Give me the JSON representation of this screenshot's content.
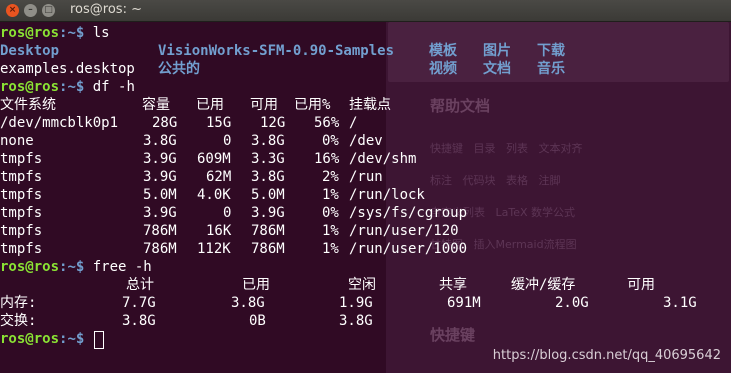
{
  "window": {
    "title": "ros@ros: ~"
  },
  "prompt": {
    "user_host": "ros@ros",
    "suffix": ":~$ "
  },
  "cmd1": "ls",
  "ls": {
    "row1": [
      "Desktop",
      "VisionWorks-SFM-0.90-Samples",
      "模板",
      "图片",
      "下载"
    ],
    "row2": [
      "examples.desktop",
      "公共的",
      "视频",
      "文档",
      "音乐"
    ]
  },
  "cmd2": "df -h",
  "df": {
    "headers": [
      "文件系统",
      "容量",
      "已用",
      "可用",
      "已用%",
      "挂载点"
    ],
    "rows": [
      [
        "/dev/mmcblk0p1",
        "28G",
        "15G",
        "12G",
        "56%",
        "/"
      ],
      [
        "none",
        "3.8G",
        "0",
        "3.8G",
        "0%",
        "/dev"
      ],
      [
        "tmpfs",
        "3.9G",
        "609M",
        "3.3G",
        "16%",
        "/dev/shm"
      ],
      [
        "tmpfs",
        "3.9G",
        "62M",
        "3.8G",
        "2%",
        "/run"
      ],
      [
        "tmpfs",
        "5.0M",
        "4.0K",
        "5.0M",
        "1%",
        "/run/lock"
      ],
      [
        "tmpfs",
        "3.9G",
        "0",
        "3.9G",
        "0%",
        "/sys/fs/cgroup"
      ],
      [
        "tmpfs",
        "786M",
        "16K",
        "786M",
        "1%",
        "/run/user/120"
      ],
      [
        "tmpfs",
        "786M",
        "112K",
        "786M",
        "1%",
        "/run/user/1000"
      ]
    ]
  },
  "cmd3": "free -h",
  "free": {
    "headers": [
      "总计",
      "已用",
      "空闲",
      "共享",
      "缓冲/缓存",
      "可用"
    ],
    "mem": [
      "内存:",
      "7.7G",
      "3.8G",
      "1.9G",
      "691M",
      "2.0G",
      "3.1G"
    ],
    "swap": [
      "交换:",
      "3.8G",
      "0B",
      "3.8G"
    ]
  },
  "watermark": "https://blog.csdn.net/qq_40695642",
  "colors": {
    "background": "#300a24",
    "prompt": "#8ae234",
    "directory": "#729fcf"
  }
}
